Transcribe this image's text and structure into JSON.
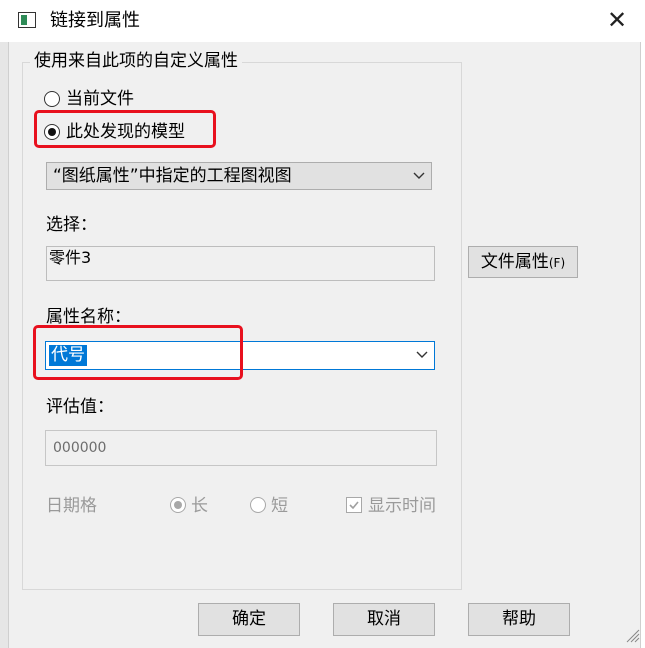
{
  "window": {
    "title": "链接到属性"
  },
  "group": {
    "legend": "使用来自此项的自定义属性"
  },
  "source_options": [
    {
      "label": "当前文件",
      "selected": false
    },
    {
      "label": "此处发现的模型",
      "selected": true
    }
  ],
  "view_combo": {
    "value": "“图纸属性”中指定的工程图视图"
  },
  "selection": {
    "label": "选择：",
    "value": "零件3"
  },
  "file_properties_button": {
    "label": "文件属性",
    "hotkey": "(F)"
  },
  "property_name": {
    "label": "属性名称：",
    "value": "代号"
  },
  "evaluated": {
    "label": "评估值：",
    "value": "000000"
  },
  "date_format": {
    "label": "日期格",
    "options": [
      {
        "label": "长",
        "selected": true
      },
      {
        "label": "短",
        "selected": false
      }
    ],
    "show_time": {
      "label": "显示时间",
      "checked": true
    }
  },
  "buttons": {
    "ok": "确定",
    "cancel": "取消",
    "help": "帮助"
  },
  "colors": {
    "highlight": "#e8101e",
    "selection_blue": "#0078d7",
    "disabled": "#9a9a9a"
  }
}
